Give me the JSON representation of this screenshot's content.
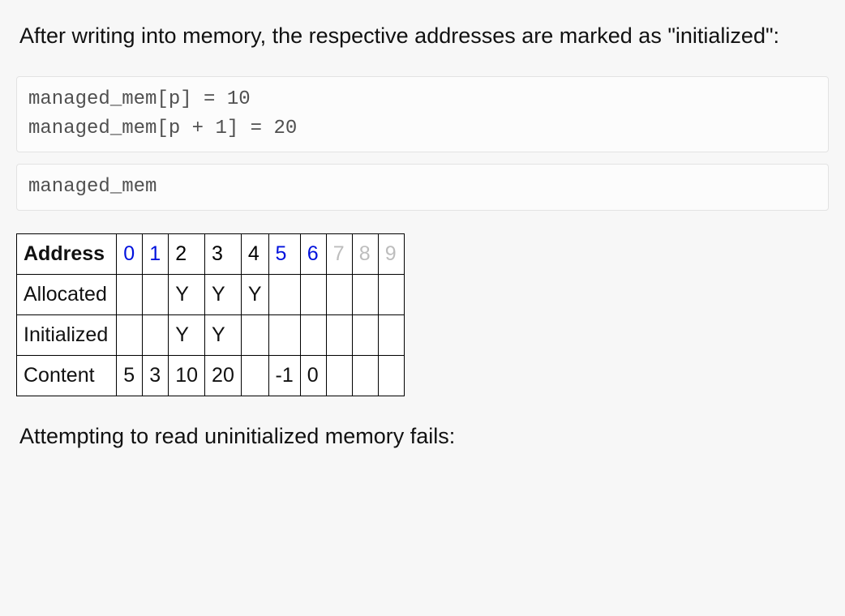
{
  "prose": {
    "intro": "After writing into memory, the respective addresses are marked as \"initialized\":",
    "outro": "Attempting to read uninitialized memory fails:"
  },
  "code": {
    "block1": "managed_mem[p] = 10\nmanaged_mem[p + 1] = 20",
    "block2": "managed_mem"
  },
  "table": {
    "header_label": "Address",
    "header_cells": [
      {
        "text": "0",
        "style": "blue"
      },
      {
        "text": "1",
        "style": "blue"
      },
      {
        "text": "2",
        "style": "black"
      },
      {
        "text": "3",
        "style": "black"
      },
      {
        "text": "4",
        "style": "black"
      },
      {
        "text": "5",
        "style": "blue"
      },
      {
        "text": "6",
        "style": "blue"
      },
      {
        "text": "7",
        "style": "grey"
      },
      {
        "text": "8",
        "style": "grey"
      },
      {
        "text": "9",
        "style": "grey"
      }
    ],
    "rows": [
      {
        "label": "Allocated",
        "cells": [
          "",
          "",
          "Y",
          "Y",
          "Y",
          "",
          "",
          "",
          "",
          ""
        ]
      },
      {
        "label": "Initialized",
        "cells": [
          "",
          "",
          "Y",
          "Y",
          "",
          "",
          "",
          "",
          "",
          ""
        ]
      },
      {
        "label": "Content",
        "cells": [
          "5",
          "3",
          "10",
          "20",
          "",
          "-1",
          "0",
          "",
          "",
          ""
        ]
      }
    ]
  }
}
